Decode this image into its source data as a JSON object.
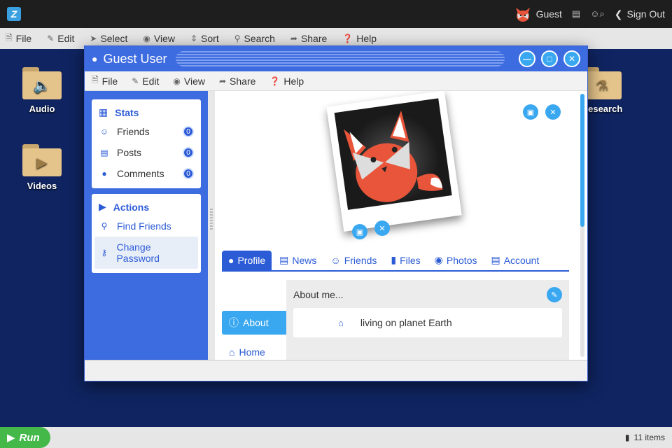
{
  "topbar": {
    "user_label": "Guest",
    "signout_label": "Sign Out"
  },
  "global_menu": [
    {
      "label": "File",
      "icon": "file-icon"
    },
    {
      "label": "Edit",
      "icon": "pencil-icon"
    },
    {
      "label": "Select",
      "icon": "cursor-icon"
    },
    {
      "label": "View",
      "icon": "eye-icon"
    },
    {
      "label": "Sort",
      "icon": "sort-icon"
    },
    {
      "label": "Search",
      "icon": "search-icon"
    },
    {
      "label": "Share",
      "icon": "share-icon"
    },
    {
      "label": "Help",
      "icon": "help-icon"
    }
  ],
  "desktop": {
    "icons": [
      {
        "label": "Audio",
        "icon": "audio-icon"
      },
      {
        "label": "Videos",
        "icon": "video-icon"
      },
      {
        "label": "Research",
        "icon": "flask-icon"
      }
    ]
  },
  "window": {
    "title": "Guest User",
    "menu": [
      {
        "label": "File"
      },
      {
        "label": "Edit"
      },
      {
        "label": "View"
      },
      {
        "label": "Share"
      },
      {
        "label": "Help"
      }
    ],
    "stats": {
      "header": "Stats",
      "items": [
        {
          "label": "Friends",
          "count": "0",
          "icon": "smiley-icon"
        },
        {
          "label": "Posts",
          "count": "0",
          "icon": "posts-icon"
        },
        {
          "label": "Comments",
          "count": "0",
          "icon": "comment-icon"
        }
      ]
    },
    "actions": {
      "header": "Actions",
      "items": [
        {
          "label": "Find Friends",
          "icon": "search-icon"
        },
        {
          "label": "Change Password",
          "icon": "key-icon"
        }
      ]
    },
    "tabs": [
      {
        "label": "Profile",
        "icon": "user-icon"
      },
      {
        "label": "News",
        "icon": "news-icon"
      },
      {
        "label": "Friends",
        "icon": "smiley-icon"
      },
      {
        "label": "Files",
        "icon": "file-icon"
      },
      {
        "label": "Photos",
        "icon": "camera-icon"
      },
      {
        "label": "Account",
        "icon": "account-icon"
      }
    ],
    "subnav": [
      {
        "label": "About",
        "icon": "info-icon"
      },
      {
        "label": "Home",
        "icon": "home-icon"
      }
    ],
    "about": {
      "header": "About me...",
      "home_text": "living on planet Earth"
    }
  },
  "taskbar": {
    "run_label": "Run",
    "items_count": "11 items"
  },
  "colors": {
    "desktop_bg": "#0f2460",
    "accent": "#3d6be0",
    "button_blue": "#3aa8f0",
    "run_green": "#44b94a"
  }
}
